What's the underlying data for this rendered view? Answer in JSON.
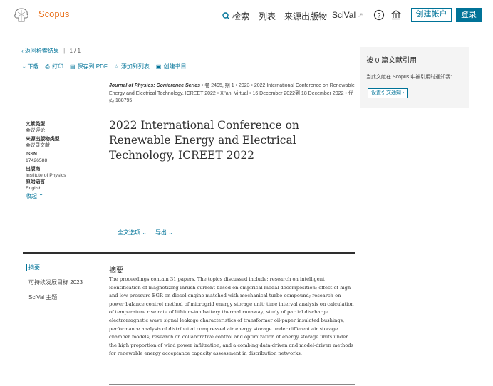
{
  "header": {
    "brand": "Scopus",
    "nav": {
      "search": "检索",
      "lists": "列表",
      "sources": "来源出版物",
      "scival": "SciVal"
    },
    "create_account": "创建帐户",
    "login": "登录"
  },
  "back": {
    "label": "返回检索结果",
    "page": "1 / 1"
  },
  "actions": {
    "download": "下载",
    "print": "打印",
    "save_pdf": "保存到 PDF",
    "add_list": "添加到列表",
    "bibliography": "创建书目"
  },
  "source": {
    "journal": "Journal of Physics: Conference Series",
    "details": " • 卷 2495, 期 1 • 2023 • 2022 International Conference on Renewable Energy and Electrical Technology, ICREET 2022 • Xi'an, Virtual • 16 December 2022到 18 December 2022 • 代码 188795"
  },
  "title": "2022 International Conference on Renewable Energy and Electrical Technology, ICREET 2022",
  "meta": {
    "doc_type_label": "文献类型",
    "doc_type": "会议评论",
    "source_type_label": "来源出版物类型",
    "source_type": "会议录文献",
    "issn_label": "ISSN",
    "issn": "17426588",
    "publisher_label": "出版商",
    "publisher": "Institute of Physics",
    "language_label": "原始语言",
    "language": "English",
    "collapse": "收起"
  },
  "fulltext": {
    "options": "全文选项",
    "export": "导出"
  },
  "subnav": {
    "abstract": "摘要",
    "sdg": "可持续发展目标 2023",
    "scival_topics": "SciVal 主题"
  },
  "abstract": {
    "heading": "摘要",
    "text": "The proceedings contain 31 papers. The topics discussed include: research on intelligent identification of magnetizing inrush current based on empirical modal decomposition; effect of high and low pressure EGR on diesel engine matched with mechanical turbo-compound; research on power balance control method of microgrid energy storage unit; time interval analysis on calculation of temperature rise rate of lithium-ion battery thermal runaway; study of partial discharge electromagnetic wave signal leakage characteristics of transformer oil-paper insulated bushings; performance analysis of distributed compressed air energy storage under different air storage chamber models; research on collaborative control and optimization of energy storage units under the high proportion of wind power infiltration; and a combing data-driven and model-driven methods for renewable energy acceptance capacity assessment in distribution networks."
  },
  "citations": {
    "title": "被 0 篇文献引用",
    "desc": "当此文献在 Scopus 中被引用时通知我:",
    "button": "设置引文通知"
  },
  "colors": {
    "accent": "#007398",
    "brand": "#e9711c"
  }
}
